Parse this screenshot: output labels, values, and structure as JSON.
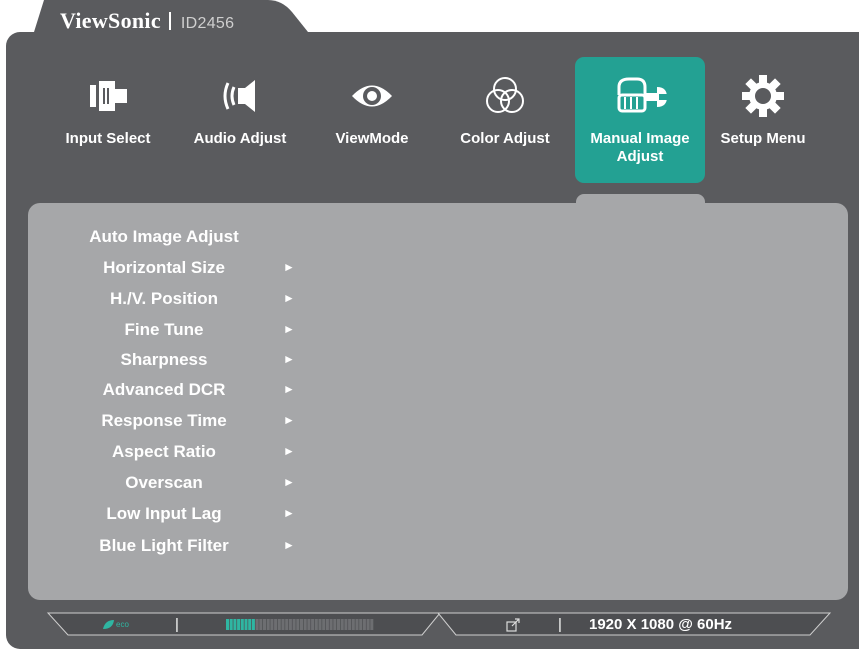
{
  "brand": {
    "name": "ViewSonic",
    "model": "ID2456"
  },
  "tabs": [
    {
      "label": "Input Select",
      "icon": "input-select-icon"
    },
    {
      "label": "Audio Adjust",
      "icon": "speaker-icon"
    },
    {
      "label": "ViewMode",
      "icon": "eye-icon"
    },
    {
      "label": "Color Adjust",
      "icon": "color-circles-icon"
    },
    {
      "label": "Manual Image Adjust",
      "icon": "hand-wrench-icon"
    },
    {
      "label": "Setup Menu",
      "icon": "gear-icon"
    }
  ],
  "menu_items": [
    {
      "label": "Auto Image Adjust",
      "arrow": ""
    },
    {
      "label": "Horizontal Size",
      "arrow": "►"
    },
    {
      "label": "H./V. Position",
      "arrow": "►"
    },
    {
      "label": "Fine Tune",
      "arrow": "►"
    },
    {
      "label": "Sharpness",
      "arrow": "►"
    },
    {
      "label": "Advanced DCR",
      "arrow": "►"
    },
    {
      "label": "Response Time",
      "arrow": "►"
    },
    {
      "label": "Aspect Ratio",
      "arrow": "►"
    },
    {
      "label": "Overscan",
      "arrow": "►"
    },
    {
      "label": "Low Input Lag",
      "arrow": "►"
    },
    {
      "label": "Blue Light Filter",
      "arrow": "►"
    }
  ],
  "footer": {
    "eco_label": "eco",
    "separator": "|",
    "resolution": "1920 X 1080 @ 60Hz",
    "energy_level": 0.2
  },
  "colors": {
    "frame": "#5a5b5e",
    "panel": "#a6a7a9",
    "accent": "#23a193",
    "eco": "#2fb6a2"
  }
}
